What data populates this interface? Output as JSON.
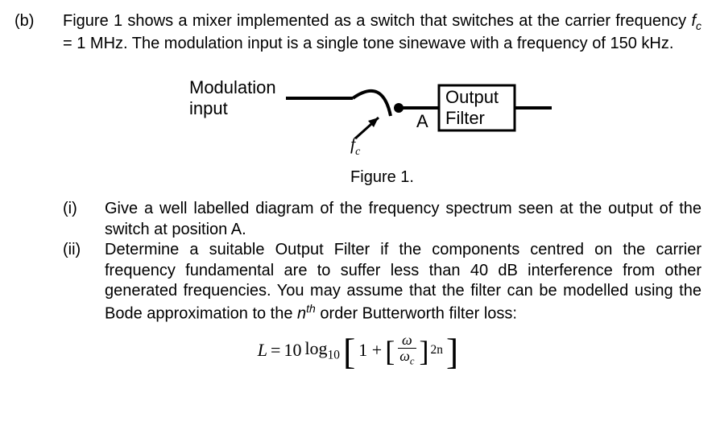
{
  "part_label": "(b)",
  "intro_pre": "Figure 1 shows a mixer implemented as a switch that switches at the carrier frequency ",
  "intro_fc": "f",
  "intro_fc_sub": "c",
  "intro_eq": " = 1 MHz. The modulation input is a single tone sinewave with a frequency of 150 kHz.",
  "figure": {
    "mod_label_l1": "Modulation",
    "mod_label_l2": "input",
    "fc_label": "f",
    "fc_sub": "c",
    "node_a": "A",
    "filter_l1": "Output",
    "filter_l2": "Filter",
    "caption": "Figure 1."
  },
  "i_label": "(i)",
  "i_text": "Give a well labelled diagram of the frequency spectrum seen at the output of the switch at position A.",
  "ii_label": "(ii)",
  "ii_text_pre": "Determine a suitable Output Filter if the components centred on the carrier frequency fundamental are to suffer less than 40 dB interference from other generated frequencies. You may assume that the filter can be modelled using the Bode approximation to the ",
  "ii_nth_n": "n",
  "ii_nth_sup": "th",
  "ii_text_post": " order Butterworth filter loss:",
  "eq": {
    "L": "L",
    "eq_sign": " = ",
    "ten": "10",
    "log": " log",
    "log_sub": "10",
    "one_plus": "1 + ",
    "omega": "ω",
    "omega_c": "ω",
    "omega_c_sub": "c",
    "exp": "2n"
  }
}
